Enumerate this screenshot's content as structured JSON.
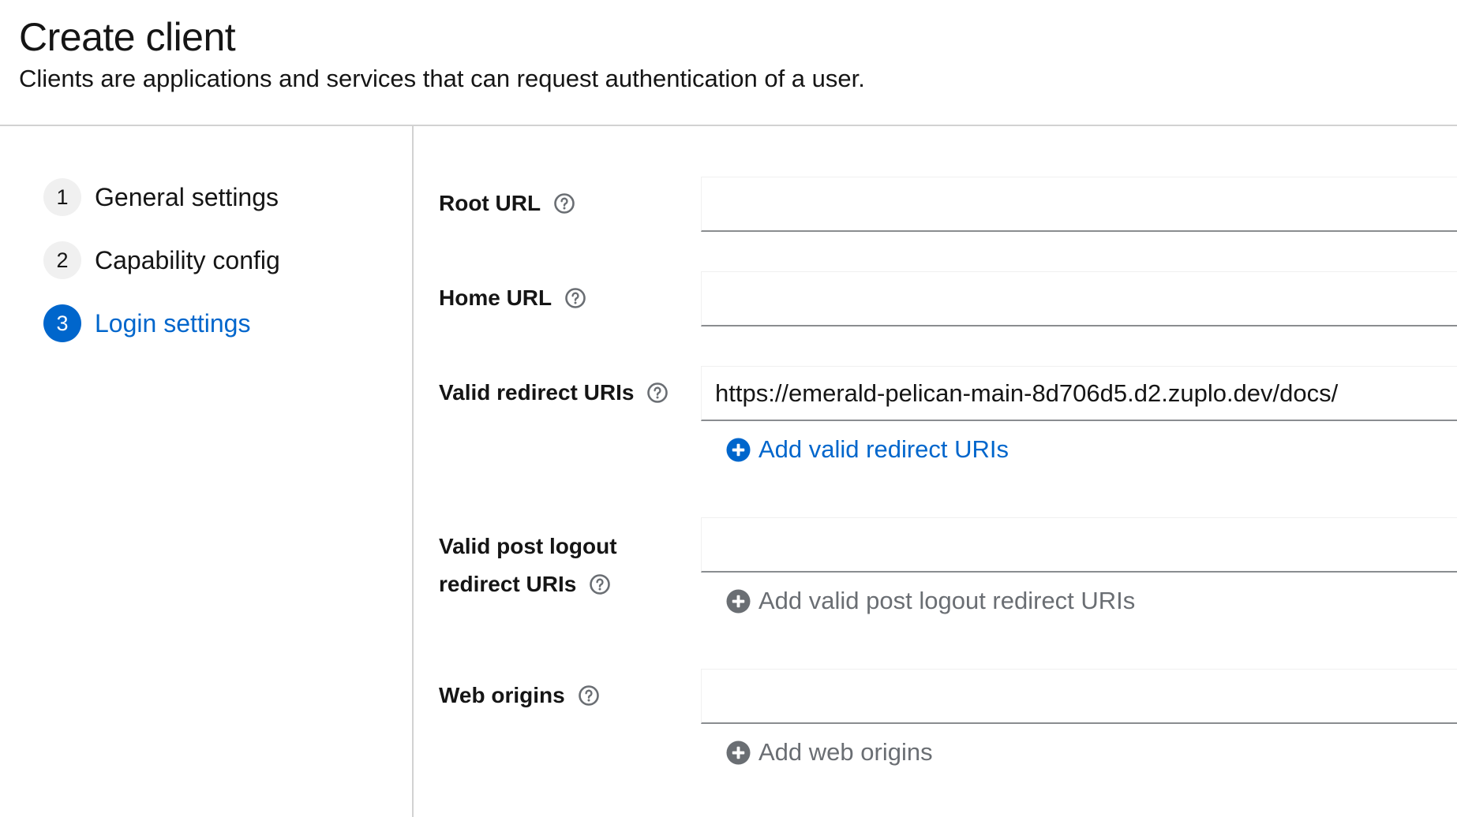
{
  "header": {
    "title": "Create client",
    "description": "Clients are applications and services that can request authentication of a user."
  },
  "wizard": {
    "steps": [
      {
        "number": "1",
        "label": "General settings",
        "active": false
      },
      {
        "number": "2",
        "label": "Capability config",
        "active": false
      },
      {
        "number": "3",
        "label": "Login settings",
        "active": true
      }
    ]
  },
  "form": {
    "root_url": {
      "label": "Root URL",
      "value": ""
    },
    "home_url": {
      "label": "Home URL",
      "value": ""
    },
    "valid_redirect_uris": {
      "label": "Valid redirect URIs",
      "value": "https://emerald-pelican-main-8d706d5.d2.zuplo.dev/docs/",
      "add_label": "Add valid redirect URIs"
    },
    "valid_post_logout": {
      "label_line1": "Valid post logout",
      "label_line2": "redirect URIs",
      "value": "",
      "add_label": "Add valid post logout redirect URIs"
    },
    "web_origins": {
      "label": "Web origins",
      "value": "",
      "add_label": "Add web origins"
    }
  },
  "icons": {
    "help": "question-circle-icon",
    "add": "plus-circle-icon"
  },
  "colors": {
    "accent": "#0066cc",
    "disabled": "#6a6e73",
    "text": "#151515",
    "border": "#d2d2d2"
  }
}
